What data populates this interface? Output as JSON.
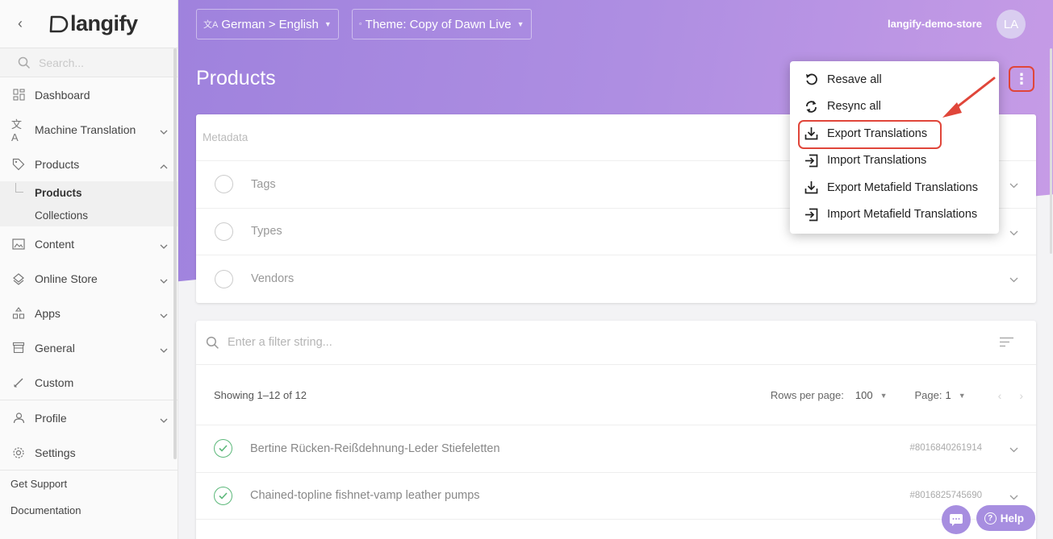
{
  "sidebar": {
    "logo_text": "langify",
    "search_placeholder": "Search...",
    "items": [
      {
        "label": "Dashboard"
      },
      {
        "label": "Machine Translation"
      },
      {
        "label": "Products"
      },
      {
        "label": "Content"
      },
      {
        "label": "Online Store"
      },
      {
        "label": "Apps"
      },
      {
        "label": "General"
      },
      {
        "label": "Custom"
      },
      {
        "label": "Profile"
      },
      {
        "label": "Settings"
      }
    ],
    "sub_items": [
      {
        "label": "Products"
      },
      {
        "label": "Collections"
      }
    ],
    "footer": [
      {
        "label": "Get Support"
      },
      {
        "label": "Documentation"
      }
    ]
  },
  "topbar": {
    "language": "German > English",
    "theme": "Theme: Copy of Dawn Live",
    "store": "langify-demo-store",
    "avatar": "LA"
  },
  "page": {
    "title": "Products",
    "kebab": "⋮"
  },
  "metadata": {
    "label": "Metadata",
    "rows": [
      {
        "label": "Tags"
      },
      {
        "label": "Types"
      },
      {
        "label": "Vendors"
      }
    ]
  },
  "list": {
    "filter_placeholder": "Enter a filter string...",
    "showing": "Showing 1–12 of 12",
    "rows_per_page_label": "Rows per page:",
    "rows_per_page": "100",
    "page_label": "Page:",
    "page": "1",
    "products": [
      {
        "name": "Bertine Rücken-Reißdehnung-Leder Stiefeletten",
        "id": "#8016840261914"
      },
      {
        "name": "Chained-topline fishnet-vamp leather pumps",
        "id": "#8016825745690"
      }
    ]
  },
  "menu": {
    "items": [
      {
        "label": "Resave all",
        "icon": "undo-icon"
      },
      {
        "label": "Resync all",
        "icon": "sync-icon"
      },
      {
        "label": "Export Translations",
        "icon": "download-icon"
      },
      {
        "label": "Import Translations",
        "icon": "import-icon"
      },
      {
        "label": "Export Metafield Translations",
        "icon": "download-icon"
      },
      {
        "label": "Import Metafield Translations",
        "icon": "import-icon"
      }
    ]
  },
  "help": {
    "label": "Help"
  },
  "colors": {
    "accent": "#a88ce0",
    "annotation": "#e0463a",
    "success": "#5cb87a"
  }
}
